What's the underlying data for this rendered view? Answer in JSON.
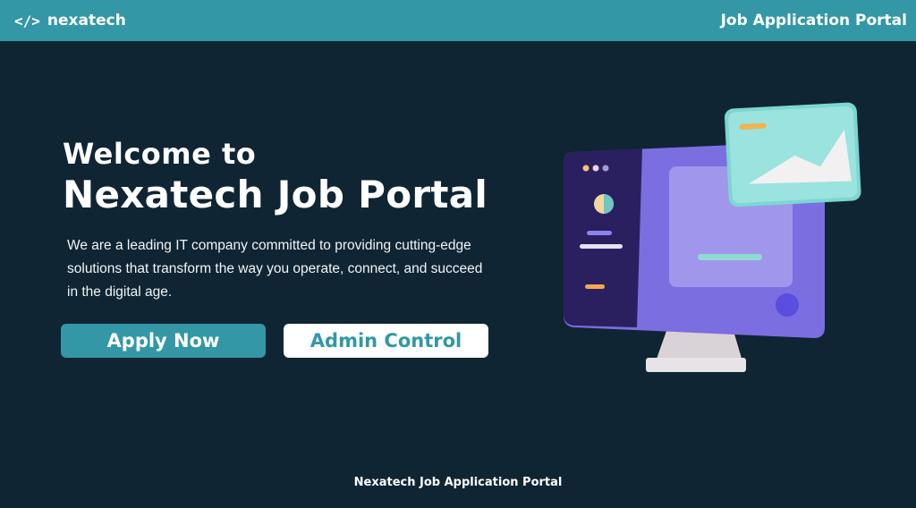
{
  "header": {
    "brand_icon": "</>",
    "brand_name": "nexatech",
    "portal_title": "Job Application Portal"
  },
  "hero": {
    "welcome": "Welcome to",
    "headline": "Nexatech Job Portal",
    "description": "We are a leading IT company committed to providing cutting-edge solutions that transform the way you operate, connect, and succeed in the digital age."
  },
  "buttons": {
    "apply_label": "Apply Now",
    "admin_label": "Admin Control"
  },
  "footer": {
    "text": "Nexatech Job Application Portal"
  },
  "colors": {
    "background": "#0f2533",
    "accent": "#3397a6",
    "monitor": "#7b6ee0"
  },
  "icons": {
    "brand": "code-icon",
    "illustration": "monitor-illustration"
  }
}
